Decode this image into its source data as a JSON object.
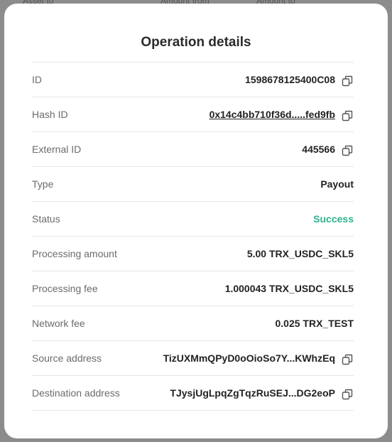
{
  "background_header": {
    "col1": "Asset to",
    "col2": "Amount from",
    "col3": "Amount to"
  },
  "modal": {
    "title": "Operation details",
    "rows": [
      {
        "label": "ID",
        "value": "1598678125400C08",
        "copy": true
      },
      {
        "label": "Hash ID",
        "value": "0x14c4bb710f36d.....fed9fb",
        "copy": true,
        "link": true
      },
      {
        "label": "External ID",
        "value": "445566",
        "copy": true
      },
      {
        "label": "Type",
        "value": "Payout"
      },
      {
        "label": "Status",
        "value": "Success",
        "status_color": "#2bb38f"
      },
      {
        "label": "Processing amount",
        "value": "5.00 TRX_USDC_SKL5"
      },
      {
        "label": "Processing fee",
        "value": "1.000043 TRX_USDC_SKL5"
      },
      {
        "label": "Network fee",
        "value": "0.025 TRX_TEST"
      },
      {
        "label": "Source address",
        "value": "TizUXMmQPyD0oOioSo7Y...KWhzEq",
        "copy": true
      },
      {
        "label": "Destination address",
        "value": "TJysjUgLpqZgTqzRuSEJ...DG2eoP",
        "copy": true
      }
    ]
  },
  "icons": {
    "copy": "copy-icon"
  }
}
